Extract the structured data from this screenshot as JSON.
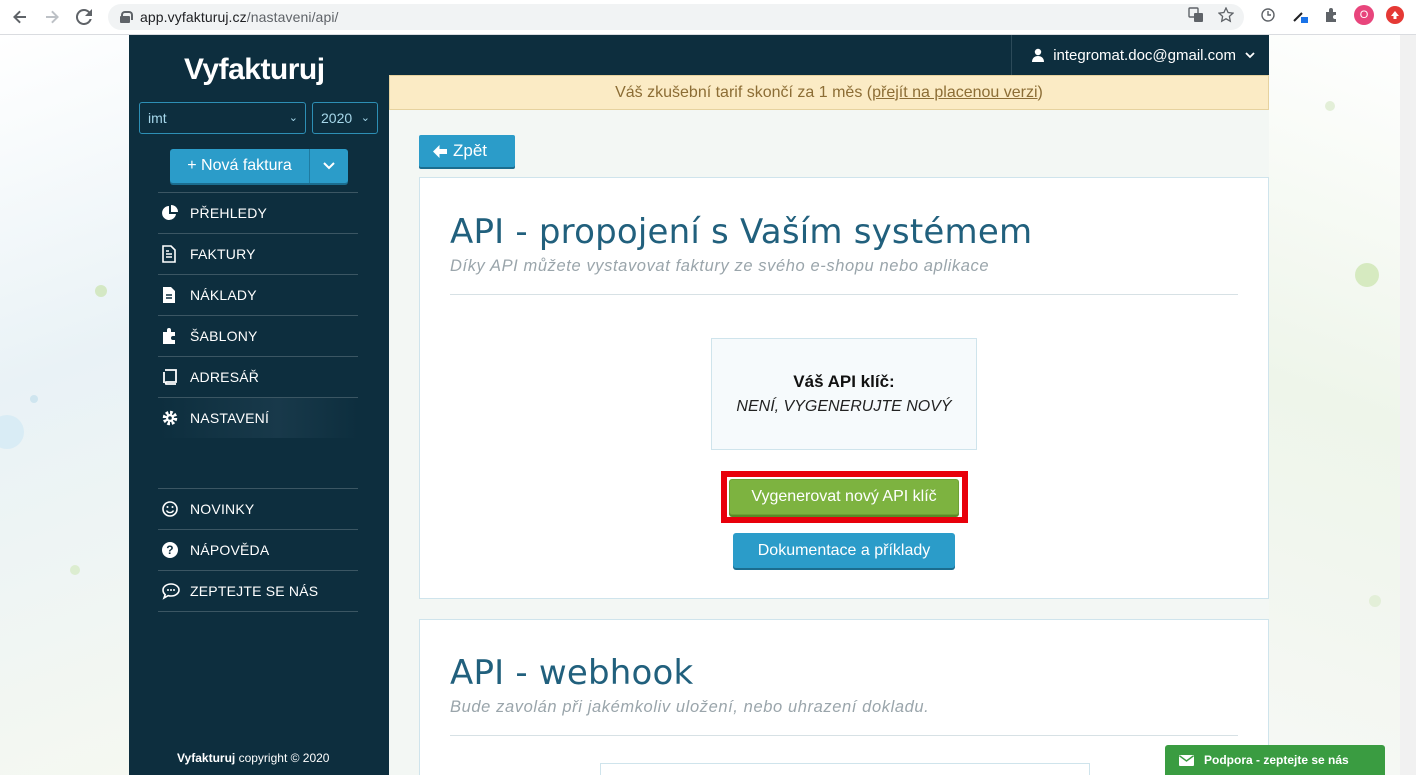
{
  "browser": {
    "url_host": "app.vyfakturuj.cz",
    "url_path": "/nastaveni/api/",
    "profile_initial": "O"
  },
  "sidebar": {
    "logo": "Vyfakturuj",
    "company_select": "imt",
    "year_select": "2020",
    "new_invoice_label": "+ Nová faktura",
    "items": [
      {
        "label": "PŘEHLEDY",
        "icon": "pie-chart-icon"
      },
      {
        "label": "FAKTURY",
        "icon": "document-icon"
      },
      {
        "label": "NÁKLADY",
        "icon": "receipt-icon"
      },
      {
        "label": "ŠABLONY",
        "icon": "puzzle-icon"
      },
      {
        "label": "ADRESÁŘ",
        "icon": "address-book-icon"
      },
      {
        "label": "NASTAVENÍ",
        "icon": "gear-icon"
      }
    ],
    "items2": [
      {
        "label": "NOVINKY",
        "icon": "smile-icon"
      },
      {
        "label": "NÁPOVĚDA",
        "icon": "help-icon"
      },
      {
        "label": "ZEPTEJTE SE NÁS",
        "icon": "chat-icon"
      }
    ],
    "copyright_brand": "Vyfakturuj",
    "copyright_text": " copyright © 2020"
  },
  "header": {
    "user_email": "integromat.doc@gmail.com"
  },
  "trial": {
    "text": "Váš zkušební tarif skončí za 1 měs (",
    "link": "přejít na placenou verzi",
    "suffix": ")"
  },
  "back_label": "Zpět",
  "api_card": {
    "title": "API - propojení s Vaším systémem",
    "subtitle": "Díky API můžete vystavovat faktury ze svého e-shopu nebo aplikace",
    "key_label": "Váš API klíč:",
    "key_value": "NENÍ, VYGENERUJTE NOVÝ",
    "generate_label": "Vygenerovat nový API klíč",
    "docs_label": "Dokumentace a příklady"
  },
  "webhook_card": {
    "title": "API - webhook",
    "subtitle": "Bude zavolán při jakémkoliv uložení, nebo uhrazení dokladu."
  },
  "support_label": "Podpora - zeptejte se nás",
  "colors": {
    "sidebar": "#0d2e3e",
    "primary": "#2b9cc9",
    "success": "#7db340",
    "highlight": "#e8000b"
  }
}
